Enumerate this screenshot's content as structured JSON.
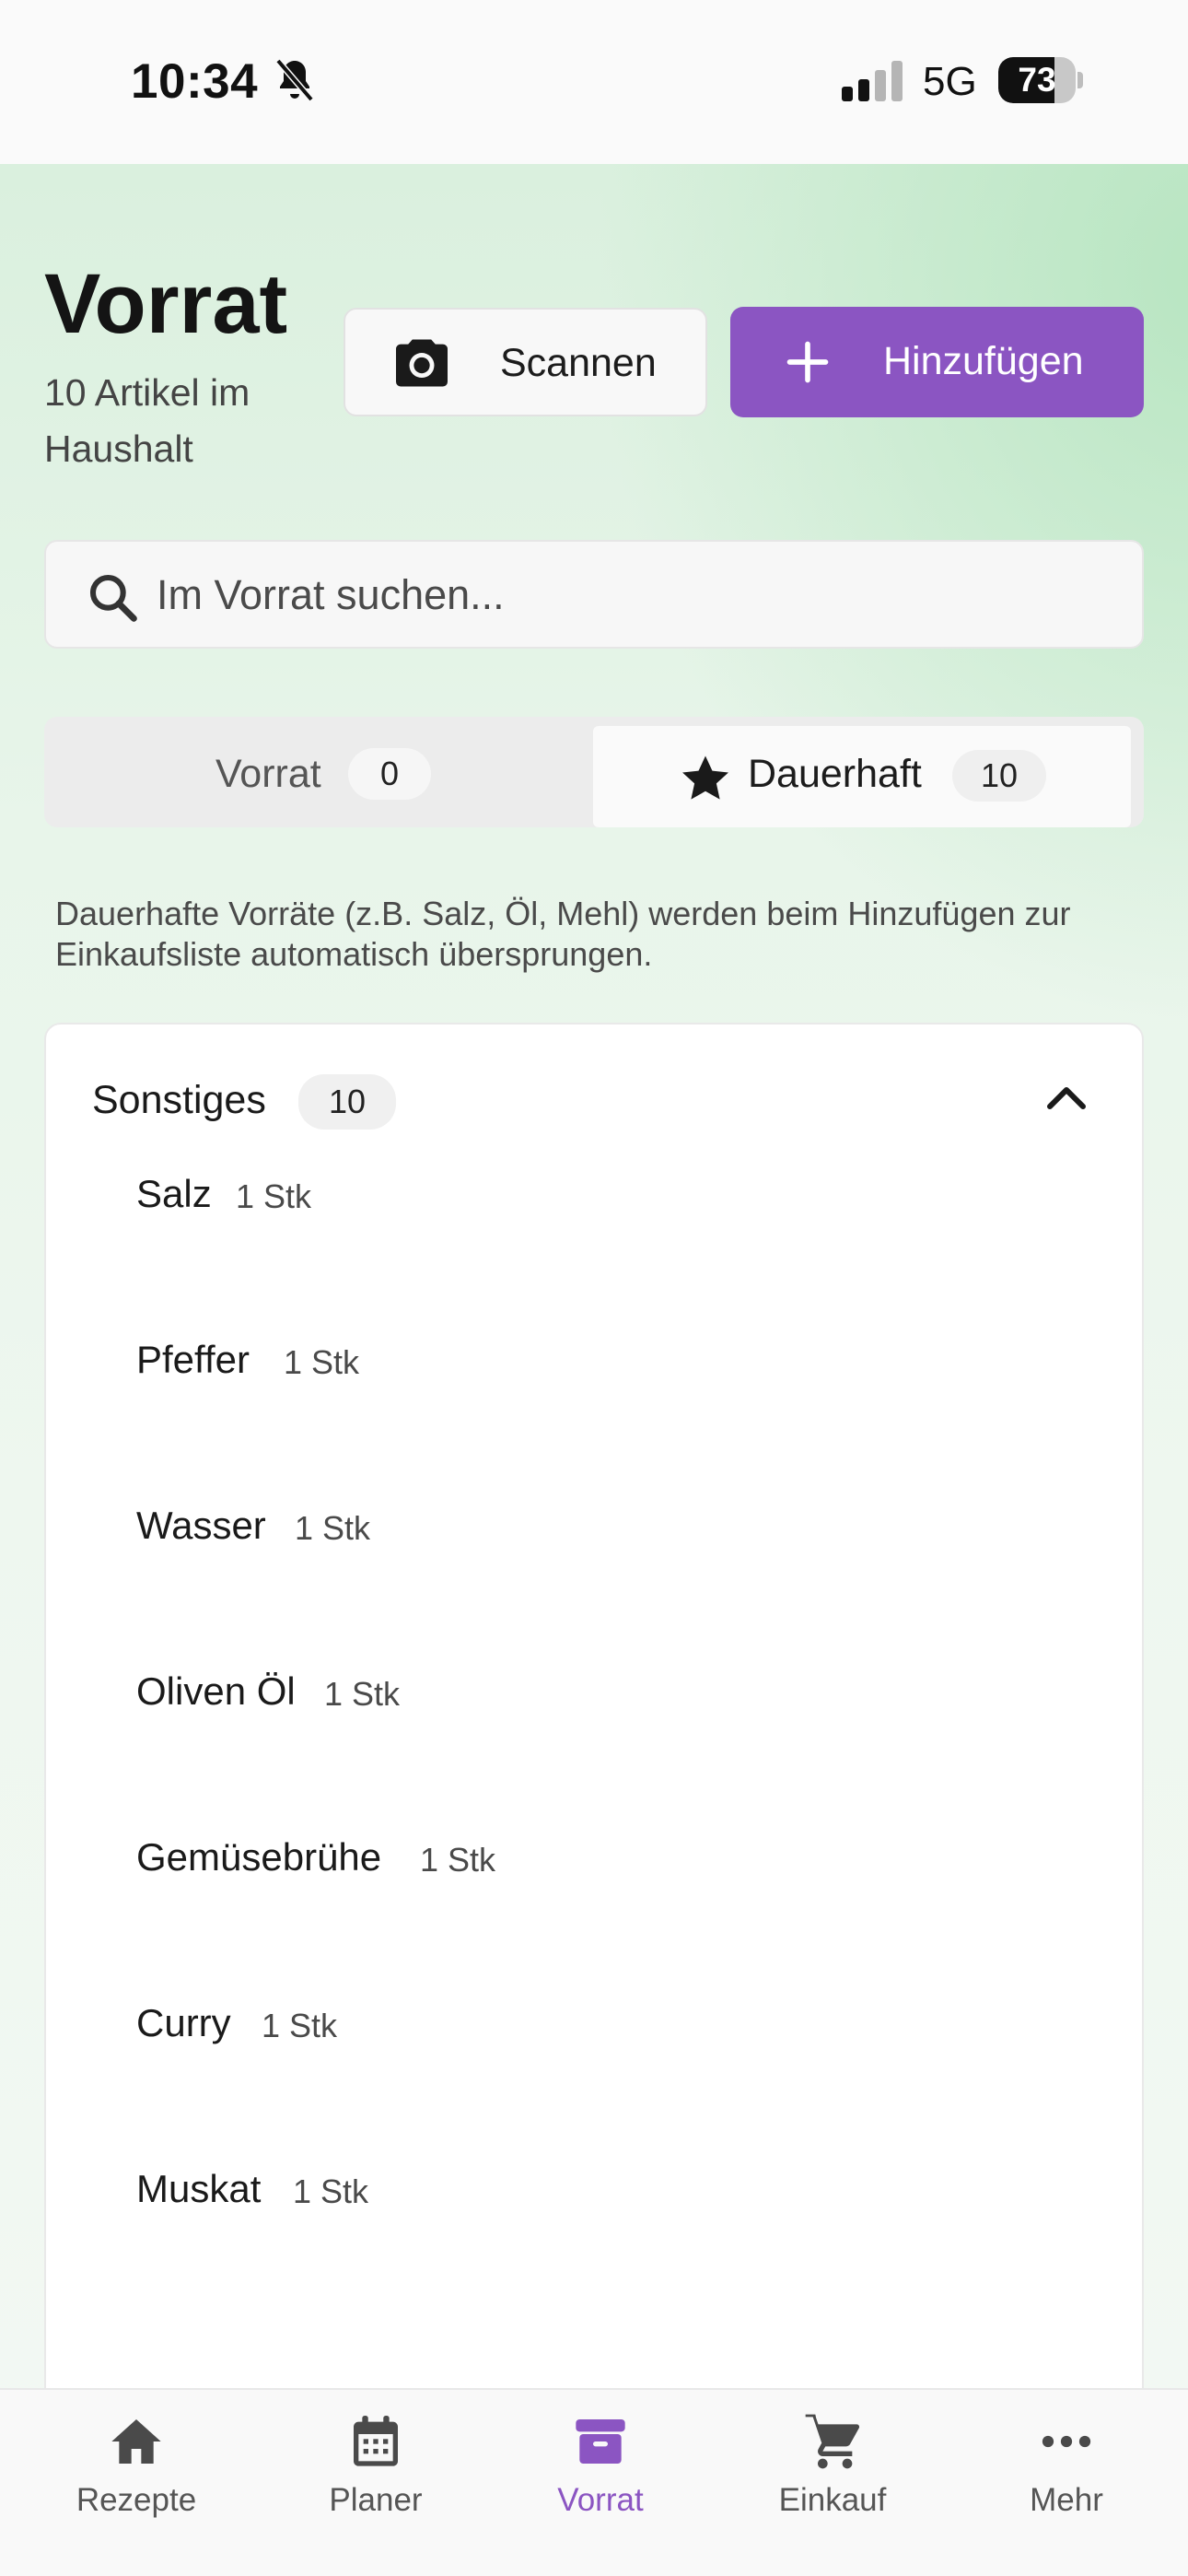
{
  "status_bar": {
    "time": "10:34",
    "network": "5G",
    "battery_percent": 73,
    "battery_label": "73",
    "icons": [
      "bell-slash-icon",
      "cellular-signal-icon",
      "battery-icon"
    ]
  },
  "header": {
    "title": "Vorrat",
    "subtitle": "10 Artikel im Haushalt",
    "scan_label": "Scannen",
    "add_label": "Hinzufügen"
  },
  "search": {
    "placeholder": "Im Vorrat suchen..."
  },
  "tabs": [
    {
      "label": "Vorrat",
      "count": "0",
      "active": false
    },
    {
      "label": "Dauerhaft",
      "count": "10",
      "active": true
    }
  ],
  "hint": "Dauerhafte Vorräte (z.B. Salz, Öl, Mehl) werden beim Hinzufügen zur Einkaufsliste automatisch übersprungen.",
  "category": {
    "label": "Sonstiges",
    "count": "10",
    "expanded": true,
    "items": [
      {
        "name": "Salz",
        "qty": "1 Stk"
      },
      {
        "name": "Pfeffer",
        "qty": "1 Stk"
      },
      {
        "name": "Wasser",
        "qty": "1 Stk"
      },
      {
        "name": "Oliven Öl",
        "qty": "1 Stk"
      },
      {
        "name": "Gemüsebrühe",
        "qty": "1 Stk"
      },
      {
        "name": "Curry",
        "qty": "1 Stk"
      },
      {
        "name": "Muskat",
        "qty": "1 Stk"
      }
    ]
  },
  "bottom_nav": [
    {
      "label": "Rezepte",
      "icon": "home-icon",
      "active": false
    },
    {
      "label": "Planer",
      "icon": "calendar-icon",
      "active": false
    },
    {
      "label": "Vorrat",
      "icon": "archive-box-icon",
      "active": true
    },
    {
      "label": "Einkauf",
      "icon": "shopping-cart-icon",
      "active": false
    },
    {
      "label": "Mehr",
      "icon": "more-dots-icon",
      "active": false
    }
  ],
  "colors": {
    "accent": "#8b55c2",
    "background_tint": "#e8f5ea"
  }
}
